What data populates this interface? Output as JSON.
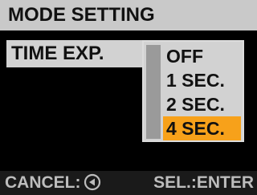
{
  "header": {
    "title": "MODE SETTING"
  },
  "setting": {
    "label": "TIME EXP."
  },
  "options": {
    "items": [
      "OFF",
      "1 SEC.",
      "2 SEC.",
      "4 SEC."
    ],
    "selected_index": 3
  },
  "footer": {
    "cancel_label": "CANCEL:",
    "cancel_icon": "left-arrow-circle-icon",
    "select_label": "SEL.:ENTER"
  },
  "colors": {
    "highlight": "#f7a11a",
    "panel": "#d2d2d2",
    "background": "#000000"
  }
}
